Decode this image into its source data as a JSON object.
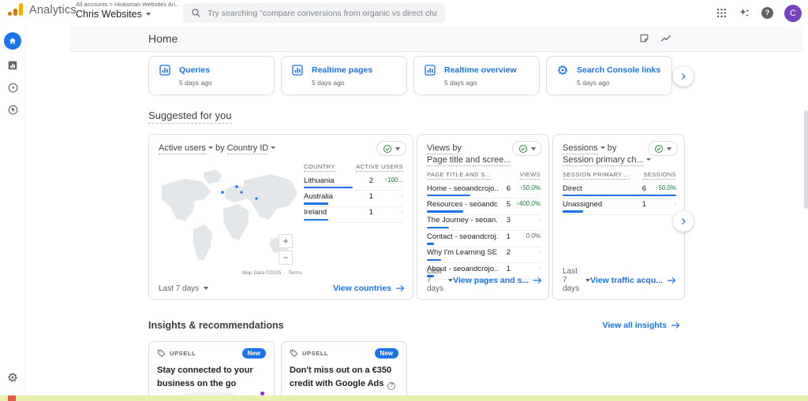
{
  "colors": {
    "accent": "#1a73e8",
    "positive": "#188038",
    "map_land": "#e4e7ea",
    "strip": "#e9efad",
    "avatar_bg": "#7642c0"
  },
  "glyphs": {
    "help": "?"
  },
  "topbar": {
    "brand": "Analytics",
    "breadcrumb": "All accounts > Hinksman Websites An..",
    "account": "Chris Websites",
    "search_placeholder": "Try searching \"compare conversions from organic vs direct channels\"",
    "avatar_initial": "C"
  },
  "header": {
    "title": "Home"
  },
  "shortcuts": [
    {
      "icon": "insights-chart",
      "label": "Queries",
      "time": "5 days ago"
    },
    {
      "icon": "insights-chart",
      "label": "Realtime pages",
      "time": "5 days ago"
    },
    {
      "icon": "insights-chart",
      "label": "Realtime overview",
      "time": "5 days ago"
    },
    {
      "icon": "search-console-gear",
      "label": "Search Console links",
      "time": "5 days ago"
    }
  ],
  "suggested": {
    "heading": "Suggested for you",
    "active_users_card": {
      "title_metric": "Active users",
      "title_join": "by",
      "title_dimension": "Country ID",
      "columns": [
        "COUNTRY",
        "ACTIVE USERS"
      ],
      "rows": [
        {
          "name": "Lithuania",
          "value": "2",
          "change": "↑100...",
          "bar": 62
        },
        {
          "name": "Australia",
          "value": "1",
          "change": "-",
          "bar": 31
        },
        {
          "name": "Ireland",
          "value": "1",
          "change": "-",
          "bar": 31
        }
      ],
      "map": {
        "attribution": "Map Data ©2025",
        "terms": "Terms",
        "zoom_in": "+",
        "zoom_out": "−"
      },
      "range": "Last 7 days",
      "link": "View countries"
    },
    "views_card": {
      "title_line1": "Views by",
      "title_line2": "Page title and scree...",
      "columns": [
        "PAGE TITLE AND S...",
        "VIEWS"
      ],
      "rows": [
        {
          "name": "Home - seoandcrojo...",
          "value": "6",
          "change": "↑50.0%",
          "bar": 55
        },
        {
          "name": "Resources - seoandc...",
          "value": "5",
          "change": "↑400.0%",
          "bar": 46
        },
        {
          "name": "The Journey - seoan...",
          "value": "3",
          "change": "-",
          "bar": 28
        },
        {
          "name": "Contact - seoandcroj...",
          "value": "1",
          "change": "0.0%",
          "bar": 9
        },
        {
          "name": "Why I'm Learning SE...",
          "value": "2",
          "change": "-",
          "bar": 18
        },
        {
          "name": "About - seoandcrojo...",
          "value": "1",
          "change": "-",
          "bar": 9
        }
      ],
      "range": "Last 7 days",
      "link": "View pages and s..."
    },
    "sessions_card": {
      "title_line1_metric": "Sessions",
      "title_line1_join": "by",
      "title_line2": "Session primary ch...",
      "columns": [
        "SESSION PRIMARY ...",
        "SESSIONS"
      ],
      "rows": [
        {
          "name": "Direct",
          "value": "6",
          "change": "↑50.0%",
          "bar": 144
        },
        {
          "name": "Unassigned",
          "value": "1",
          "change": "-",
          "bar": 26
        }
      ],
      "range": "Last 7 days",
      "link": "View traffic acqu..."
    }
  },
  "insights": {
    "heading": "Insights & recommendations",
    "view_all": "View all insights",
    "cards": [
      {
        "tag": "UPSELL",
        "badge": "New",
        "text": "Stay connected to your business on the go",
        "illustration": "phone-teaser"
      },
      {
        "tag": "UPSELL",
        "badge": "New",
        "text": "Don't miss out on a €350 credit with Google Ads",
        "has_help": true
      }
    ]
  }
}
